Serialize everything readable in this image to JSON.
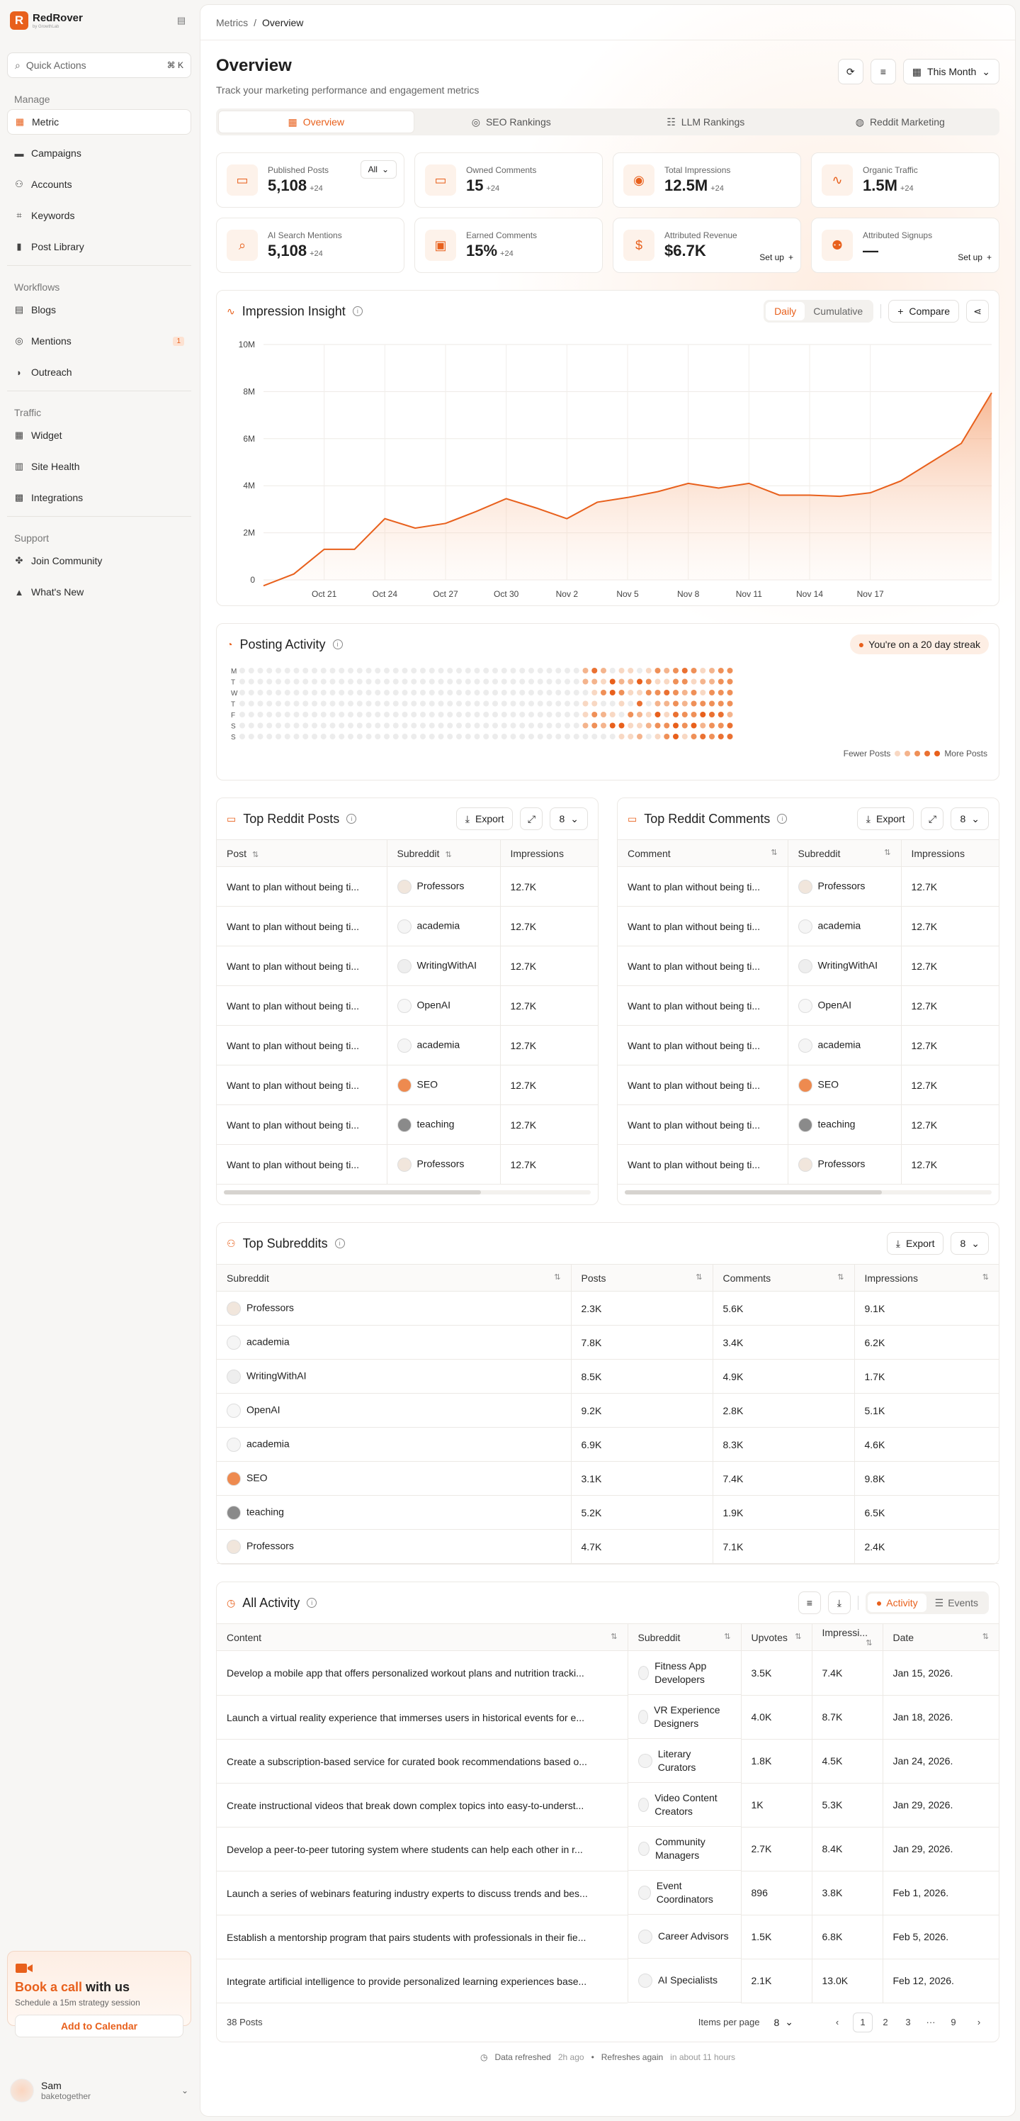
{
  "brand": {
    "name": "RedRover",
    "sub": "by GrowthLab",
    "logo_letter": "R"
  },
  "sidebar": {
    "quick_actions": {
      "label": "Quick Actions",
      "shortcut": "⌘ K"
    },
    "groups": [
      {
        "title": "Manage",
        "items": [
          {
            "label": "Metric",
            "icon": "grid-icon",
            "active": true
          },
          {
            "label": "Campaigns",
            "icon": "folder-icon"
          },
          {
            "label": "Accounts",
            "icon": "users-icon"
          },
          {
            "label": "Keywords",
            "icon": "tag-icon"
          },
          {
            "label": "Post Library",
            "icon": "book-icon"
          }
        ]
      },
      {
        "title": "Workflows",
        "items": [
          {
            "label": "Blogs",
            "icon": "doc-icon"
          },
          {
            "label": "Mentions",
            "icon": "at-icon",
            "badge": "1"
          },
          {
            "label": "Outreach",
            "icon": "send-icon"
          }
        ]
      },
      {
        "title": "Traffic",
        "items": [
          {
            "label": "Widget",
            "icon": "widget-icon"
          },
          {
            "label": "Site Health",
            "icon": "health-icon"
          },
          {
            "label": "Integrations",
            "icon": "plug-icon"
          }
        ]
      },
      {
        "title": "Support",
        "items": [
          {
            "label": "Join Community",
            "icon": "community-icon"
          },
          {
            "label": "What's New",
            "icon": "megaphone-icon"
          }
        ]
      }
    ],
    "book": {
      "title_hl": "Book a call",
      "title_rest": " with us",
      "sub": "Schedule a 15m strategy session",
      "button": "Add to Calendar"
    },
    "user": {
      "name": "Sam",
      "sub": "baketogether"
    }
  },
  "breadcrumb": [
    "Metrics",
    "Overview"
  ],
  "header": {
    "title": "Overview",
    "subtitle": "Track your marketing performance and engagement metrics",
    "range": "This Month"
  },
  "tabs": [
    {
      "label": "Overview",
      "active": true
    },
    {
      "label": "SEO Rankings"
    },
    {
      "label": "LLM Rankings"
    },
    {
      "label": "Reddit Marketing"
    }
  ],
  "stats": [
    {
      "label": "Published Posts",
      "value": "5,108",
      "delta": "+24",
      "pill": "All",
      "icon": "posts-icon"
    },
    {
      "label": "Owned Comments",
      "value": "15",
      "delta": "+24",
      "icon": "comment-icon"
    },
    {
      "label": "Total Impressions",
      "value": "12.5M",
      "delta": "+24",
      "icon": "eye-icon"
    },
    {
      "label": "Organic Traffic",
      "value": "1.5M",
      "delta": "+24",
      "icon": "pulse-icon"
    },
    {
      "label": "AI Search Mentions",
      "value": "5,108",
      "delta": "+24",
      "icon": "ai-search-icon"
    },
    {
      "label": "Earned Comments",
      "value": "15%",
      "delta": "+24",
      "icon": "earned-icon"
    },
    {
      "label": "Attributed Revenue",
      "value": "$6.7K",
      "delta": "",
      "setup": "Set up",
      "icon": "dollar-icon"
    },
    {
      "label": "Attributed Signups",
      "value": "—",
      "delta": "",
      "setup": "Set up",
      "icon": "user-plus-icon"
    }
  ],
  "impression": {
    "title": "Impression Insight",
    "daily": "Daily",
    "cumulative": "Cumulative",
    "compare": "Compare"
  },
  "chart_data": {
    "type": "area",
    "title": "Impression Insight",
    "ylim": [
      0,
      10000000
    ],
    "yticks": [
      "0",
      "2M",
      "4M",
      "6M",
      "8M",
      "10M"
    ],
    "xticks": [
      "Oct 21",
      "Oct 24",
      "Oct 27",
      "Oct 30",
      "Nov 2",
      "Nov 5",
      "Nov 8",
      "Nov 11",
      "Nov 14",
      "Nov 17"
    ],
    "x": [
      "Oct 18",
      "Oct 19.5",
      "Oct 21",
      "Oct 22.5",
      "Oct 24",
      "Oct 25.5",
      "Oct 27",
      "Oct 28.5",
      "Oct 30",
      "Oct 31.5",
      "Nov 1",
      "Nov 2.5",
      "Nov 4",
      "Nov 5",
      "Nov 6",
      "Nov 7",
      "Nov 8",
      "Nov 9.5",
      "Nov 11",
      "Nov 12.5",
      "Nov 14",
      "Nov 15.5",
      "Nov 17",
      "Nov 18.5",
      "Nov 20"
    ],
    "values": [
      -250000,
      250000,
      1300000,
      1300000,
      2600000,
      2200000,
      2400000,
      2900000,
      3450000,
      3050000,
      2600000,
      3300000,
      3500000,
      3750000,
      4100000,
      3900000,
      4100000,
      3600000,
      3600000,
      3550000,
      3700000,
      4200000,
      5000000,
      5800000,
      7950000
    ]
  },
  "posting": {
    "title": "Posting Activity",
    "streak": "You're on a 20 day streak",
    "days": [
      "M",
      "T",
      "W",
      "T",
      "F",
      "S",
      "S"
    ],
    "legend_less": "Fewer Posts",
    "legend_more": "More Posts"
  },
  "top_posts": {
    "title": "Top Reddit Posts",
    "export": "Export",
    "count": "8",
    "cols": [
      "Post",
      "Subreddit",
      "Impressions"
    ],
    "rows": [
      [
        "Want to plan without being ti...",
        "Professors",
        "12.7K"
      ],
      [
        "Want to plan without being ti...",
        "academia",
        "12.7K"
      ],
      [
        "Want to plan without being ti...",
        "WritingWithAI",
        "12.7K"
      ],
      [
        "Want to plan without being ti...",
        "OpenAI",
        "12.7K"
      ],
      [
        "Want to plan without being ti...",
        "academia",
        "12.7K"
      ],
      [
        "Want to plan without being ti...",
        "SEO",
        "12.7K"
      ],
      [
        "Want to plan without being ti...",
        "teaching",
        "12.7K"
      ],
      [
        "Want to plan without being ti...",
        "Professors",
        "12.7K"
      ]
    ]
  },
  "top_comments": {
    "title": "Top Reddit Comments",
    "export": "Export",
    "count": "8",
    "cols": [
      "Comment",
      "Subreddit",
      "Impressions"
    ],
    "rows": [
      [
        "Want to plan without being ti...",
        "Professors",
        "12.7K"
      ],
      [
        "Want to plan without being ti...",
        "academia",
        "12.7K"
      ],
      [
        "Want to plan without being ti...",
        "WritingWithAI",
        "12.7K"
      ],
      [
        "Want to plan without being ti...",
        "OpenAI",
        "12.7K"
      ],
      [
        "Want to plan without being ti...",
        "academia",
        "12.7K"
      ],
      [
        "Want to plan without being ti...",
        "SEO",
        "12.7K"
      ],
      [
        "Want to plan without being ti...",
        "teaching",
        "12.7K"
      ],
      [
        "Want to plan without being ti...",
        "Professors",
        "12.7K"
      ]
    ]
  },
  "top_subs": {
    "title": "Top Subreddits",
    "export": "Export",
    "count": "8",
    "cols": [
      "Subreddit",
      "Posts",
      "Comments",
      "Impressions"
    ],
    "rows": [
      [
        "Professors",
        "2.3K",
        "5.6K",
        "9.1K"
      ],
      [
        "academia",
        "7.8K",
        "3.4K",
        "6.2K"
      ],
      [
        "WritingWithAI",
        "8.5K",
        "4.9K",
        "1.7K"
      ],
      [
        "OpenAI",
        "9.2K",
        "2.8K",
        "5.1K"
      ],
      [
        "academia",
        "6.9K",
        "8.3K",
        "4.6K"
      ],
      [
        "SEO",
        "3.1K",
        "7.4K",
        "9.8K"
      ],
      [
        "teaching",
        "5.2K",
        "1.9K",
        "6.5K"
      ],
      [
        "Professors",
        "4.7K",
        "7.1K",
        "2.4K"
      ]
    ]
  },
  "activity": {
    "title": "All Activity",
    "seg_activity": "Activity",
    "seg_events": "Events",
    "cols": [
      "Content",
      "Subreddit",
      "Upvotes",
      "Impressi...",
      "Date"
    ],
    "rows": [
      [
        "Develop a mobile app that offers personalized workout plans and nutrition tracki...",
        "Fitness App Developers",
        "3.5K",
        "7.4K",
        "Jan 15, 2026."
      ],
      [
        "Launch a virtual reality experience that immerses users in historical events for e...",
        "VR Experience Designers",
        "4.0K",
        "8.7K",
        "Jan 18, 2026."
      ],
      [
        "Create a subscription-based service for curated book recommendations based o...",
        "Literary Curators",
        "1.8K",
        "4.5K",
        "Jan 24, 2026."
      ],
      [
        "Create instructional videos that break down complex topics into easy-to-underst...",
        "Video Content Creators",
        "1K",
        "5.3K",
        "Jan 29, 2026."
      ],
      [
        "Develop a peer-to-peer tutoring system where students can help each other in r...",
        "Community Managers",
        "2.7K",
        "8.4K",
        "Jan 29, 2026."
      ],
      [
        "Launch a series of webinars featuring industry experts to discuss trends and bes...",
        "Event Coordinators",
        "896",
        "3.8K",
        "Feb 1, 2026."
      ],
      [
        "Establish a mentorship program that pairs students with professionals in their fie...",
        "Career Advisors",
        "1.5K",
        "6.8K",
        "Feb 5, 2026."
      ],
      [
        "Integrate artificial intelligence to provide personalized learning experiences base...",
        "AI Specialists",
        "2.1K",
        "13.0K",
        "Feb 12, 2026."
      ]
    ],
    "total": "38 Posts",
    "per_page_label": "Items per page",
    "per_page": "8",
    "pages": [
      "1",
      "2",
      "3",
      "···",
      "9"
    ]
  },
  "footer": {
    "refreshed": "Data refreshed",
    "refreshed_ago": "2h ago",
    "again": "Refreshes again",
    "again_when": "in about 11 hours"
  },
  "colors": {
    "accent": "#e8601c"
  }
}
